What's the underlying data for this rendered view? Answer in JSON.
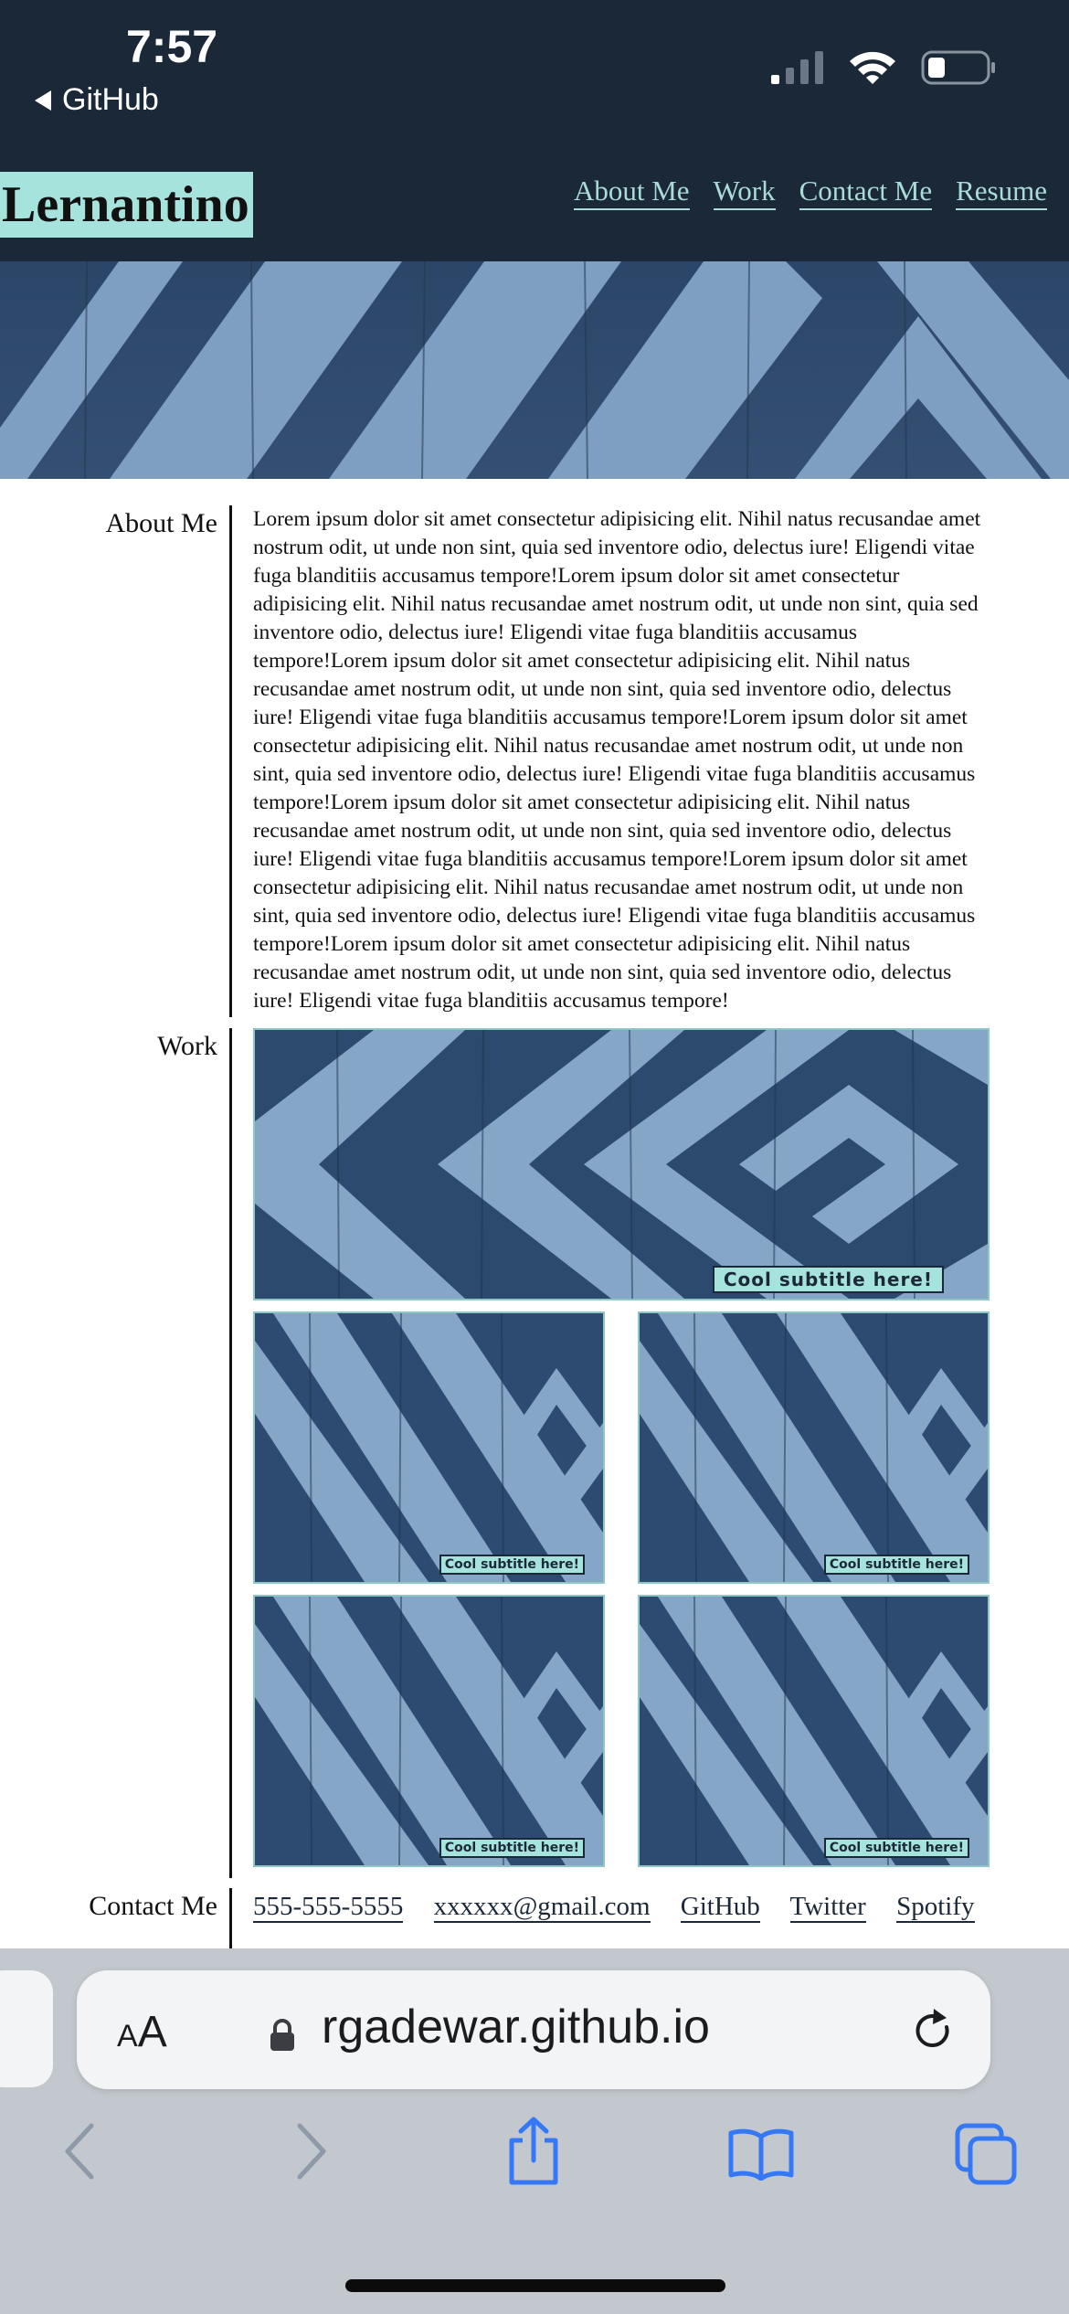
{
  "status_bar": {
    "time": "7:57",
    "back_app": "GitHub"
  },
  "site": {
    "brand": "Lernantino",
    "nav": [
      "About Me",
      "Work",
      "Contact Me",
      "Resume"
    ]
  },
  "about": {
    "heading": "About Me",
    "body": "Lorem ipsum dolor sit amet consectetur adipisicing elit. Nihil natus recusandae amet nostrum odit, ut unde non sint, quia sed inventore odio, delectus iure! Eligendi vitae fuga blanditiis accusamus tempore!Lorem ipsum dolor sit amet consectetur adipisicing elit. Nihil natus recusandae amet nostrum odit, ut unde non sint, quia sed inventore odio, delectus iure! Eligendi vitae fuga blanditiis accusamus tempore!Lorem ipsum dolor sit amet consectetur adipisicing elit. Nihil natus recusandae amet nostrum odit, ut unde non sint, quia sed inventore odio, delectus iure! Eligendi vitae fuga blanditiis accusamus tempore!Lorem ipsum dolor sit amet consectetur adipisicing elit. Nihil natus recusandae amet nostrum odit, ut unde non sint, quia sed inventore odio, delectus iure! Eligendi vitae fuga blanditiis accusamus tempore!Lorem ipsum dolor sit amet consectetur adipisicing elit. Nihil natus recusandae amet nostrum odit, ut unde non sint, quia sed inventore odio, delectus iure! Eligendi vitae fuga blanditiis accusamus tempore!Lorem ipsum dolor sit amet consectetur adipisicing elit. Nihil natus recusandae amet nostrum odit, ut unde non sint, quia sed inventore odio, delectus iure! Eligendi vitae fuga blanditiis accusamus tempore!Lorem ipsum dolor sit amet consectetur adipisicing elit. Nihil natus recusandae amet nostrum odit, ut unde non sint, quia sed inventore odio, delectus iure! Eligendi vitae fuga blanditiis accusamus tempore!"
  },
  "work": {
    "heading": "Work",
    "subtitles": [
      "Cool subtitle here!",
      "Cool subtitle here!",
      "Cool subtitle here!",
      "Cool subtitle here!",
      "Cool subtitle here!"
    ]
  },
  "contact": {
    "heading": "Contact Me",
    "links": [
      "555-555-5555",
      "xxxxxx@gmail.com",
      "GitHub",
      "Twitter",
      "Spotify"
    ]
  },
  "browser": {
    "url": "rgadewar.github.io",
    "text_size_label_small": "A",
    "text_size_label_large": "A"
  },
  "colors": {
    "header_bg": "#1b2838",
    "brand_bg": "#a6e3dc",
    "nav_link": "#a9dcd8",
    "safari_blue": "#3478f6"
  }
}
